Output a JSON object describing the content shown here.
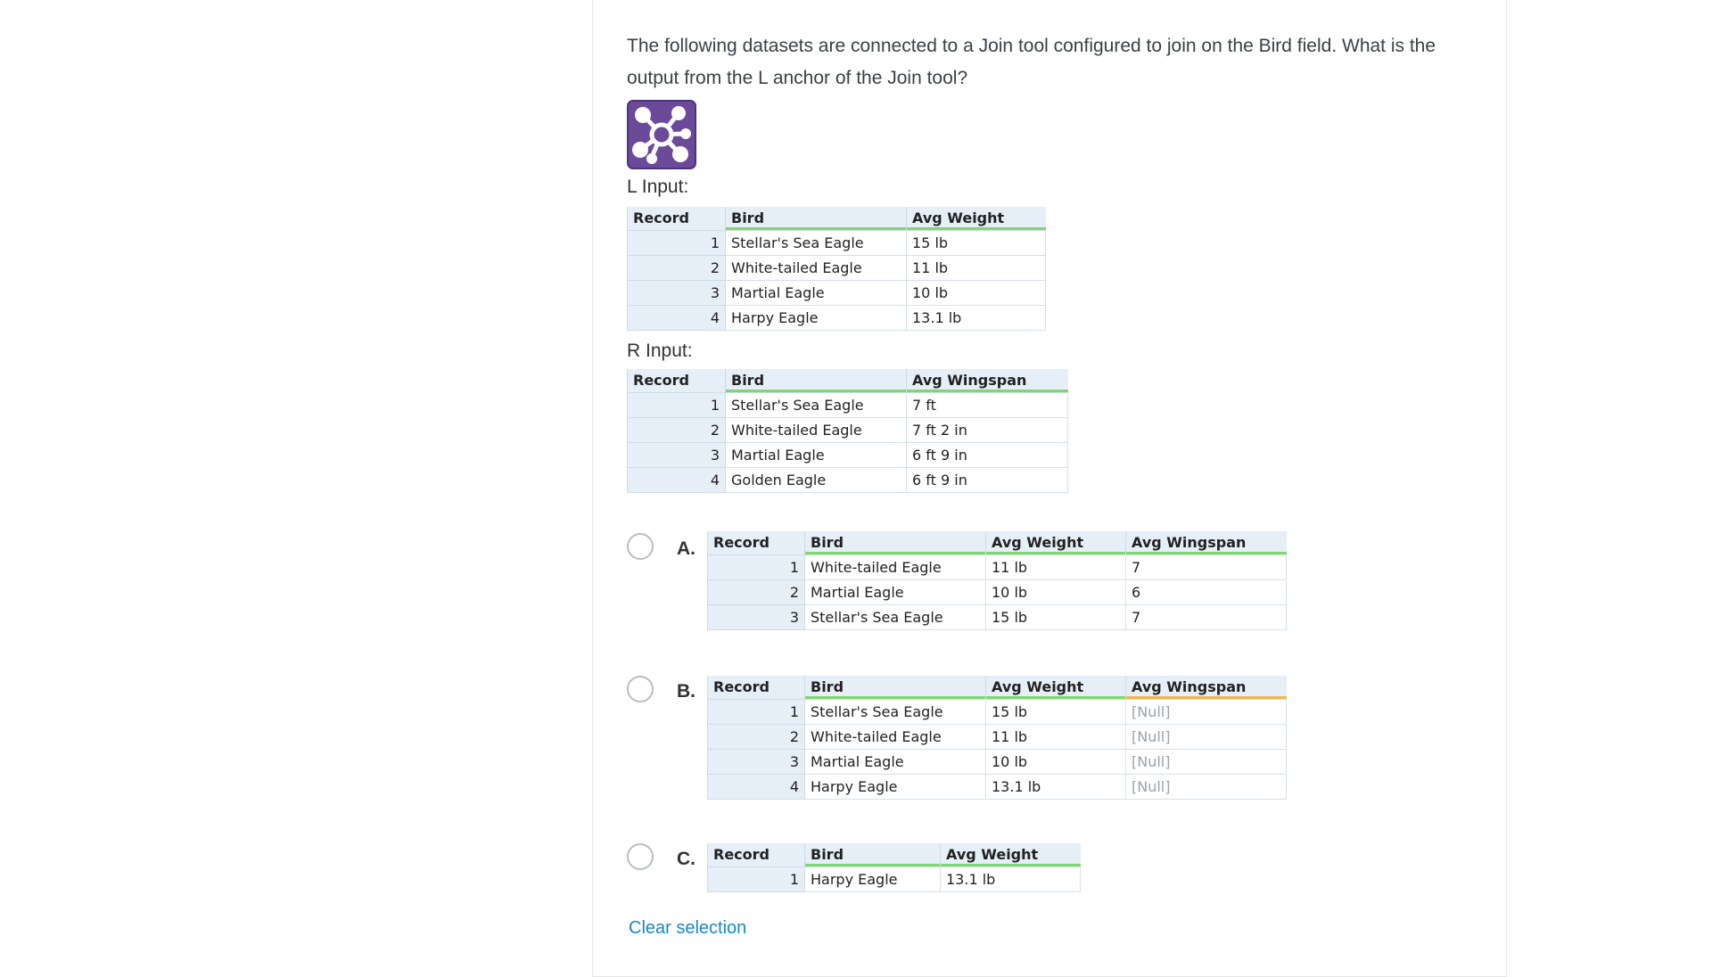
{
  "question": "The following datasets are connected to a Join tool configured to join on the Bird field. What is the output from the L anchor of the Join tool?",
  "icons": {
    "tool": "join-tool-icon"
  },
  "colors": {
    "tool_icon": "#6b4a9a",
    "link": "#1a86c8",
    "header_bg": "#e6eef7",
    "header_accent_green": "#7fd86d",
    "header_accent_orange": "#f2b84b"
  },
  "l_input": {
    "label": "L Input:",
    "columns": [
      "Record",
      "Bird",
      "Avg Weight"
    ],
    "rows": [
      [
        "1",
        "Stellar's Sea Eagle",
        "15 lb"
      ],
      [
        "2",
        "White-tailed Eagle",
        "11 lb"
      ],
      [
        "3",
        "Martial Eagle",
        "10 lb"
      ],
      [
        "4",
        "Harpy Eagle",
        "13.1 lb"
      ]
    ]
  },
  "r_input": {
    "label": "R Input:",
    "columns": [
      "Record",
      "Bird",
      "Avg Wingspan"
    ],
    "rows": [
      [
        "1",
        "Stellar's Sea Eagle",
        "7 ft"
      ],
      [
        "2",
        "White-tailed Eagle",
        "7 ft 2 in"
      ],
      [
        "3",
        "Martial Eagle",
        "6 ft 9 in"
      ],
      [
        "4",
        "Golden Eagle",
        "6 ft 9 in"
      ]
    ]
  },
  "options": [
    {
      "letter": "A.",
      "columns": [
        "Record",
        "Bird",
        "Avg Weight",
        "Avg Wingspan"
      ],
      "rows": [
        [
          "1",
          "White-tailed Eagle",
          "11 lb",
          "7"
        ],
        [
          "2",
          "Martial Eagle",
          "10 lb",
          "6"
        ],
        [
          "3",
          "Stellar's Sea Eagle",
          "15 lb",
          "7"
        ]
      ]
    },
    {
      "letter": "B.",
      "columns": [
        "Record",
        "Bird",
        "Avg Weight",
        "Avg Wingspan"
      ],
      "rows": [
        [
          "1",
          "Stellar's Sea Eagle",
          "15 lb",
          "[Null]"
        ],
        [
          "2",
          "White-tailed Eagle",
          "11 lb",
          "[Null]"
        ],
        [
          "3",
          "Martial Eagle",
          "10 lb",
          "[Null]"
        ],
        [
          "4",
          "Harpy Eagle",
          "13.1 lb",
          "[Null]"
        ]
      ]
    },
    {
      "letter": "C.",
      "columns": [
        "Record",
        "Bird",
        "Avg Weight"
      ],
      "rows": [
        [
          "1",
          "Harpy Eagle",
          "13.1 lb"
        ]
      ]
    }
  ],
  "clear_label": "Clear selection"
}
